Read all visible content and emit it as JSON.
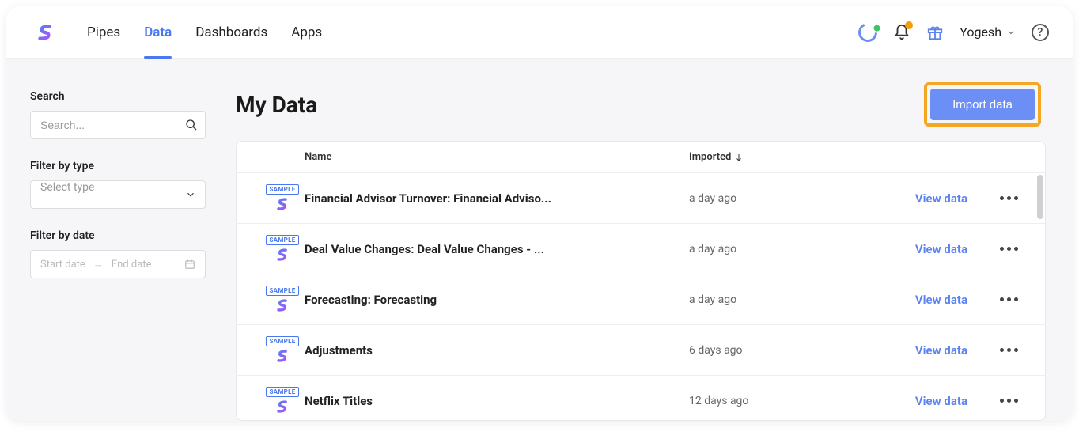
{
  "nav": {
    "tabs": [
      "Pipes",
      "Data",
      "Dashboards",
      "Apps"
    ],
    "active_index": 1
  },
  "user": {
    "name": "Yogesh"
  },
  "sidebar": {
    "search_label": "Search",
    "search_placeholder": "Search...",
    "filter_type_label": "Filter by type",
    "filter_type_placeholder": "Select type",
    "filter_date_label": "Filter by date",
    "date_start_placeholder": "Start date",
    "date_end_placeholder": "End date"
  },
  "main": {
    "title": "My Data",
    "import_label": "Import data",
    "columns": {
      "name": "Name",
      "imported": "Imported"
    },
    "view_label": "View data",
    "sample_badge": "SAMPLE"
  },
  "rows": [
    {
      "name": "Financial Advisor Turnover: Financial Adviso...",
      "imported": "a day ago"
    },
    {
      "name": "Deal Value Changes: Deal Value Changes - ...",
      "imported": "a day ago"
    },
    {
      "name": "Forecasting: Forecasting",
      "imported": "a day ago"
    },
    {
      "name": "Adjustments",
      "imported": "6 days ago"
    },
    {
      "name": "Netflix Titles",
      "imported": "12 days ago"
    }
  ]
}
